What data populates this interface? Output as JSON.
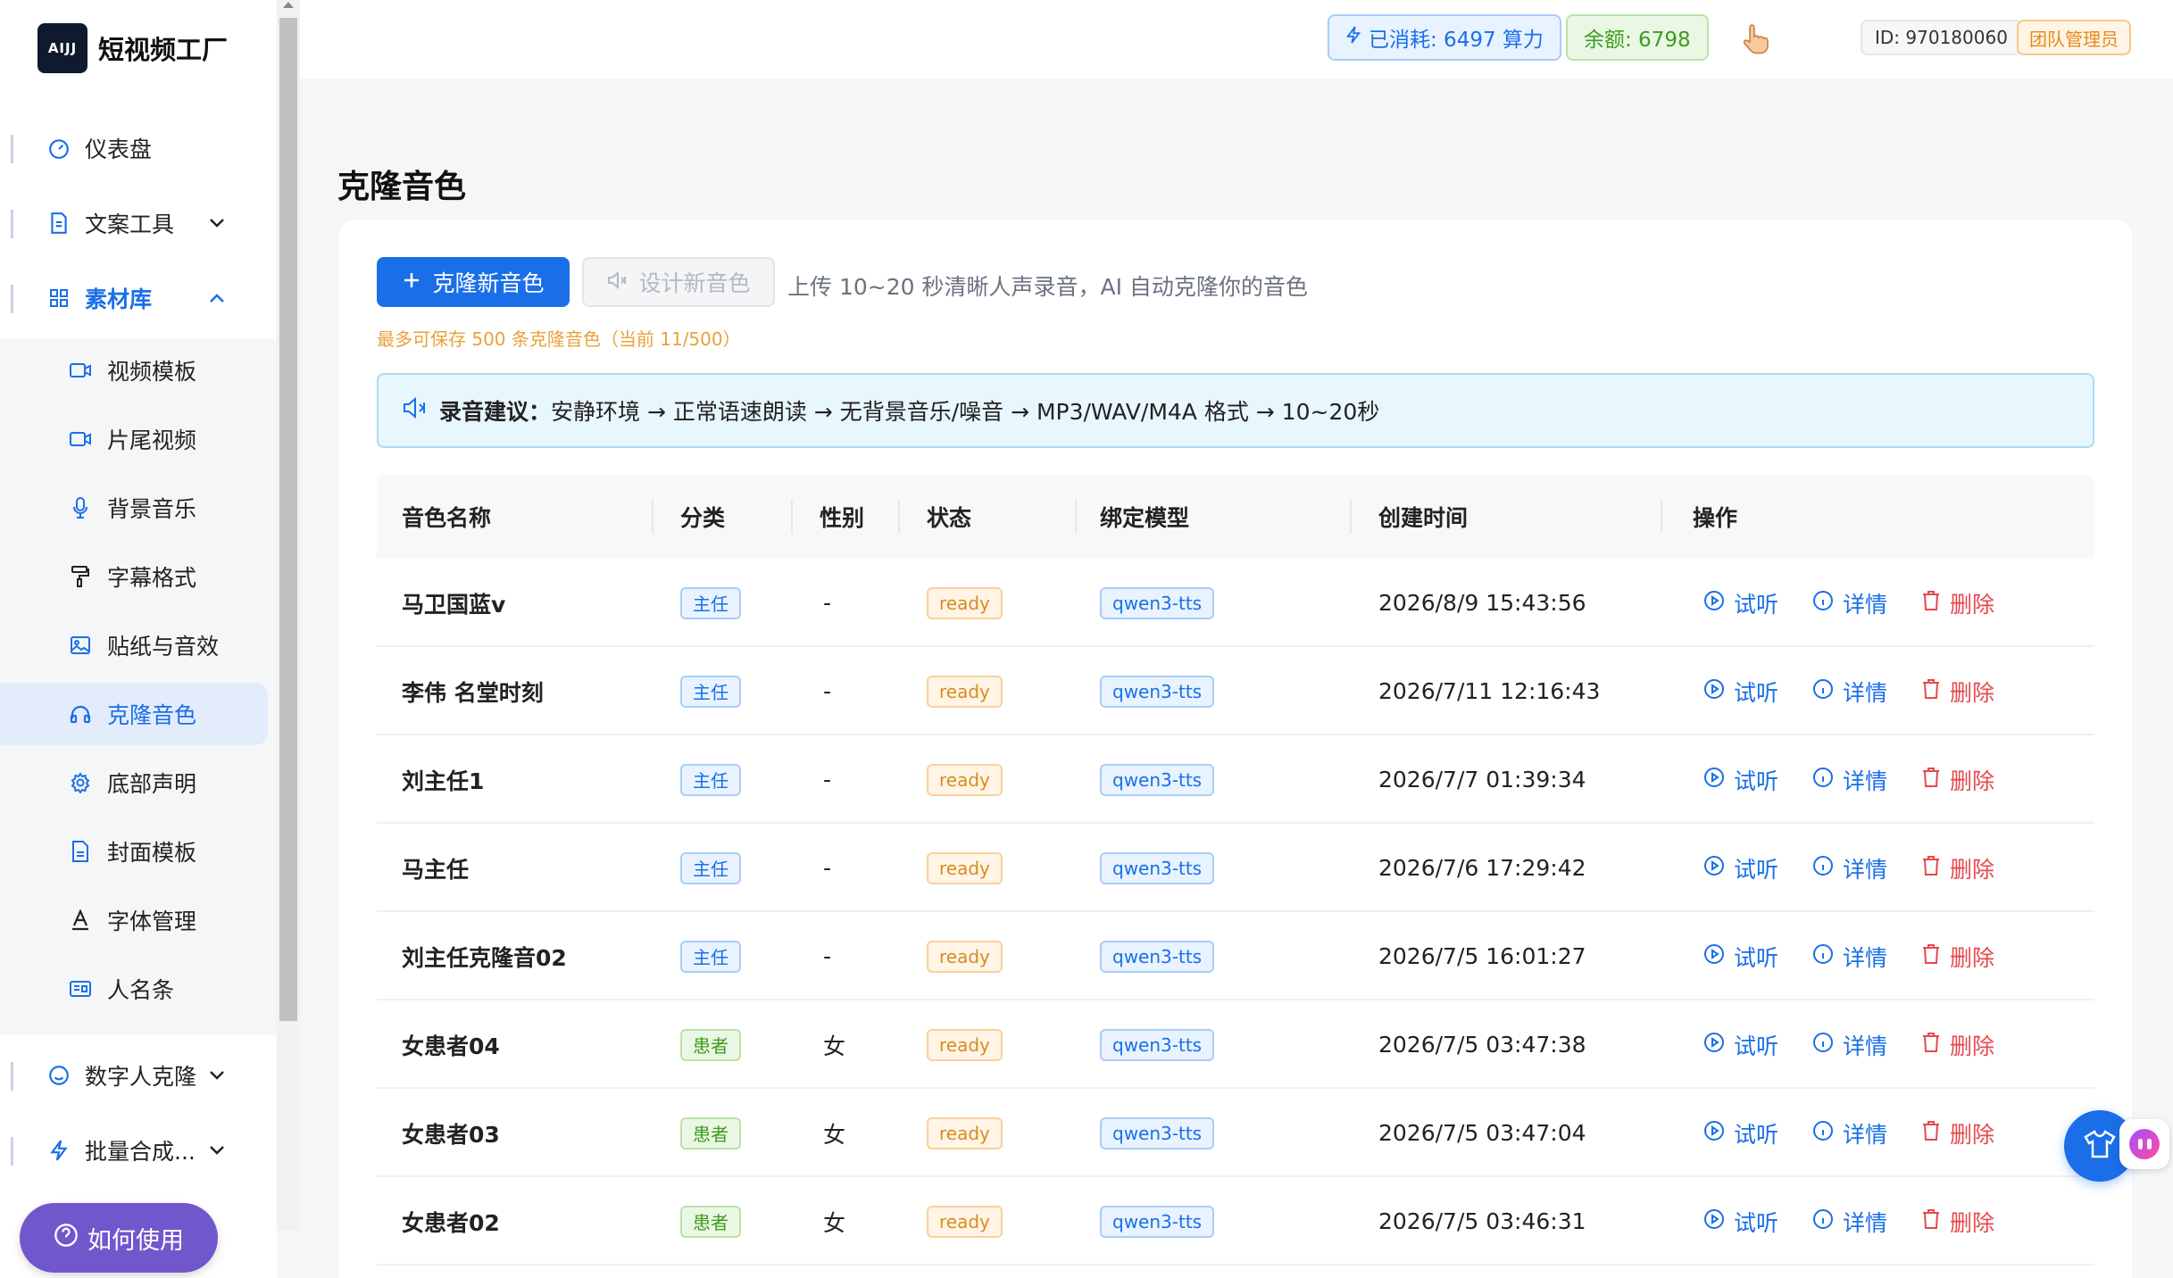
{
  "app": {
    "logo_mark": "AIJJ",
    "name": "短视频工厂"
  },
  "topbar": {
    "consumed": "已消耗: 6497 算力",
    "balance": "余额: 6798",
    "user_id": "ID: 970180060",
    "role": "团队管理员"
  },
  "sidebar": {
    "items": [
      {
        "label": "仪表盘",
        "icon": "dashboard-icon"
      },
      {
        "label": "文案工具",
        "icon": "document-icon"
      },
      {
        "label": "素材库",
        "icon": "grid-icon"
      },
      {
        "label": "数字人克隆",
        "icon": "smile-icon"
      },
      {
        "label": "批量合成...",
        "icon": "lightning-icon"
      }
    ],
    "sub_items": [
      {
        "label": "视频模板",
        "icon": "video-icon"
      },
      {
        "label": "片尾视频",
        "icon": "video-icon"
      },
      {
        "label": "背景音乐",
        "icon": "microphone-icon"
      },
      {
        "label": "字幕格式",
        "icon": "paint-roller-icon"
      },
      {
        "label": "贴纸与音效",
        "icon": "image-icon"
      },
      {
        "label": "克隆音色",
        "icon": "headphones-icon"
      },
      {
        "label": "底部声明",
        "icon": "settings-icon"
      },
      {
        "label": "封面模板",
        "icon": "file-icon"
      },
      {
        "label": "字体管理",
        "icon": "font-icon"
      },
      {
        "label": "人名条",
        "icon": "id-card-icon"
      }
    ],
    "help_label": "如何使用"
  },
  "page": {
    "title": "克隆音色",
    "clone_button": "克隆新音色",
    "design_button": "设计新音色",
    "hint": "上传 10~20 秒清晰人声录音，AI 自动克隆你的音色",
    "limit": "最多可保存 500 条克隆音色（当前 11/500）",
    "notice_label": "录音建议：",
    "notice_text": "安静环境 → 正常语速朗读 → 无背景音乐/噪音 → MP3/WAV/M4A 格式 → 10~20秒"
  },
  "table": {
    "headers": [
      "音色名称",
      "分类",
      "性别",
      "状态",
      "绑定模型",
      "创建时间",
      "操作"
    ],
    "actions": {
      "play": "试听",
      "detail": "详情",
      "delete": "删除"
    },
    "rows": [
      {
        "name": "马卫国蓝v",
        "category": "主任",
        "gender": "-",
        "status": "ready",
        "model": "qwen3-tts",
        "created": "2026/8/9 15:43:56"
      },
      {
        "name": "李伟 名堂时刻",
        "category": "主任",
        "gender": "-",
        "status": "ready",
        "model": "qwen3-tts",
        "created": "2026/7/11 12:16:43"
      },
      {
        "name": "刘主任1",
        "category": "主任",
        "gender": "-",
        "status": "ready",
        "model": "qwen3-tts",
        "created": "2026/7/7 01:39:34"
      },
      {
        "name": "马主任",
        "category": "主任",
        "gender": "-",
        "status": "ready",
        "model": "qwen3-tts",
        "created": "2026/7/6 17:29:42"
      },
      {
        "name": "刘主任克隆音02",
        "category": "主任",
        "gender": "-",
        "status": "ready",
        "model": "qwen3-tts",
        "created": "2026/7/5 16:01:27"
      },
      {
        "name": "女患者04",
        "category": "患者",
        "gender": "女",
        "status": "ready",
        "model": "qwen3-tts",
        "created": "2026/7/5 03:47:38"
      },
      {
        "name": "女患者03",
        "category": "患者",
        "gender": "女",
        "status": "ready",
        "model": "qwen3-tts",
        "created": "2026/7/5 03:47:04"
      },
      {
        "name": "女患者02",
        "category": "患者",
        "gender": "女",
        "status": "ready",
        "model": "qwen3-tts",
        "created": "2026/7/5 03:46:31"
      }
    ]
  }
}
